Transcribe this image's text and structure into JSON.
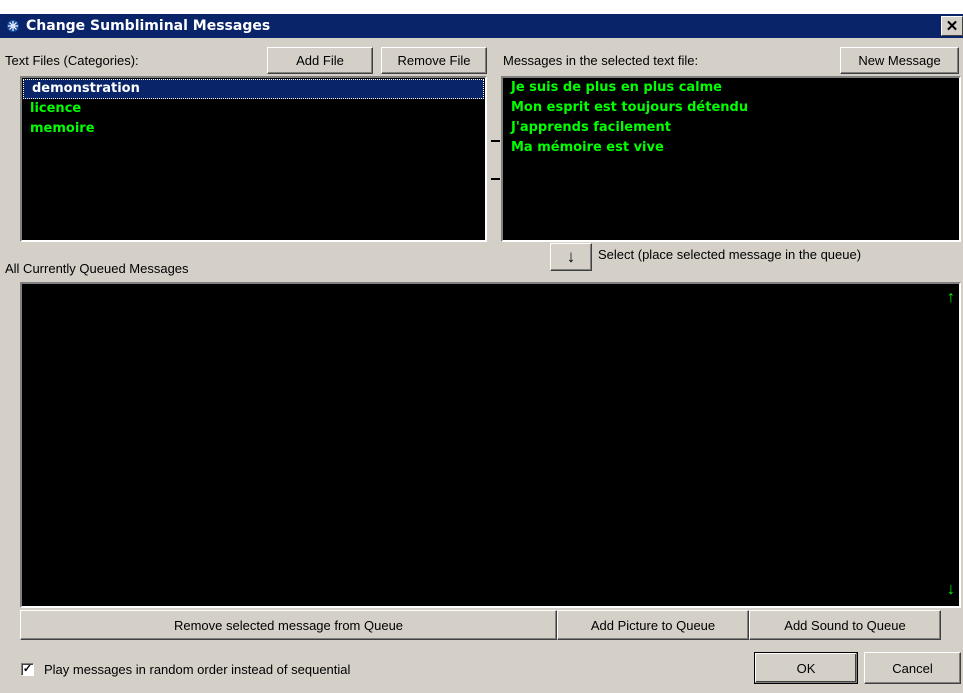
{
  "window": {
    "title": "Change Sumbliminal Messages",
    "close_glyph": "✕"
  },
  "files_panel": {
    "label": "Text Files (Categories):",
    "add_button": "Add File",
    "remove_button": "Remove File",
    "items": [
      "demonstration",
      "licence",
      "memoire"
    ],
    "selected_index": 0
  },
  "messages_panel": {
    "label": "Messages in the selected text file:",
    "new_button": "New Message",
    "items": [
      "Je suis de plus en plus calme",
      "Mon esprit est toujours détendu",
      "J'apprends facilement",
      "Ma mémoire est vive"
    ]
  },
  "select_row": {
    "arrow_glyph": "↓",
    "label": "Select (place selected message in the queue)"
  },
  "queue_panel": {
    "label": "All Currently Queued Messages",
    "up_arrow": "↑",
    "down_arrow": "↓",
    "items": []
  },
  "queue_buttons": {
    "remove": "Remove selected message from Queue",
    "add_picture": "Add Picture to Queue",
    "add_sound": "Add Sound to Queue"
  },
  "options": {
    "random_label": "Play messages in random order instead of sequential",
    "random_checked": true,
    "check_glyph": "✓"
  },
  "dialog_buttons": {
    "ok": "OK",
    "cancel": "Cancel"
  },
  "colors": {
    "title_bar": "#0a246a",
    "list_bg": "#000000",
    "list_text": "#00ff00",
    "dialog_bg": "#d4d0c8"
  }
}
